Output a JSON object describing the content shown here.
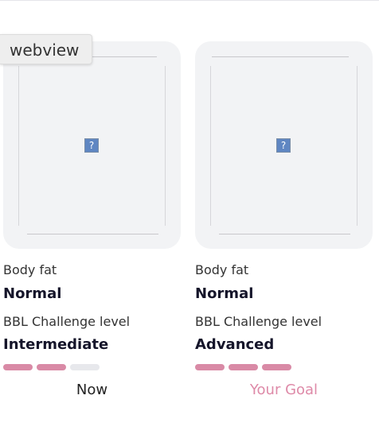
{
  "overlay": {
    "label": "webview"
  },
  "cards": [
    {
      "body_fat_label": "Body fat",
      "body_fat_value": "Normal",
      "level_label": "BBL Challenge level",
      "level_value": "Intermediate",
      "level_filled": 2,
      "level_total": 3,
      "caption": "Now",
      "image_icon": "?"
    },
    {
      "body_fat_label": "Body fat",
      "body_fat_value": "Normal",
      "level_label": "BBL Challenge level",
      "level_value": "Advanced",
      "level_filled": 3,
      "level_total": 3,
      "caption": "Your Goal",
      "image_icon": "?"
    }
  ],
  "colors": {
    "accent": "#d98aa6",
    "goal_text": "#de8aa8",
    "bar_empty": "#e7e8ec"
  }
}
